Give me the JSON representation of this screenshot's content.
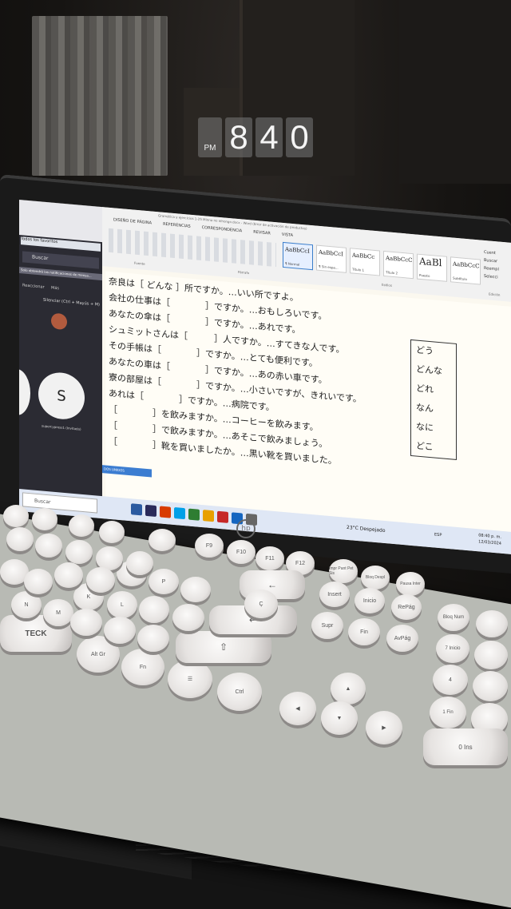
{
  "clock": {
    "period": "PM",
    "digits": [
      "8",
      "4",
      "0"
    ]
  },
  "browser": {
    "favorites": "Todos los favoritos",
    "search": "Buscar",
    "notification": "Solo obtendrá las notificaciones de mensa...",
    "react": "Reaccionar",
    "more": "Más",
    "mute_hint": "Silenciar (Ctrl + Mayús + M)",
    "avatar_letter": "S",
    "guest": "supercypress1 (Invitado)",
    "banner": "DOS UNIDOS"
  },
  "word": {
    "doc_title": "Gramática y ejercicios 1-25 Minna no nihongo.docx - Word (Error de activación de productos)",
    "tabs": [
      "DISEÑO DE PÁGINA",
      "REFERENCIAS",
      "CORRESPONDENCIA",
      "REVISAR",
      "VISTA"
    ],
    "styles": [
      {
        "sample": "AaBbCcI",
        "name": "¶ Normal"
      },
      {
        "sample": "AaBbCcI",
        "name": "¶ Sin espa..."
      },
      {
        "sample": "AaBbCc",
        "name": "Título 1"
      },
      {
        "sample": "AaBbCcC",
        "name": "Título 2"
      },
      {
        "sample": "AaBl",
        "name": "Puesto"
      },
      {
        "sample": "AaBbCcC",
        "name": "Subtítulo"
      }
    ],
    "right_tools": [
      "Cuent",
      "Buscar",
      "Reempl",
      "Selecci"
    ],
    "groups": {
      "fuente": "Fuente",
      "parrafo": "Párrafo",
      "estilos": "Estilos",
      "edicion": "Edición"
    },
    "lines": [
      "奈良は［ どんな ］所ですか。…いい所ですよ。",
      "会社の仕事は［　　　　］ですか。…おもしろいです。",
      "あなたの傘は［　　　　］ですか。…あれです。",
      "シュミットさんは［　　　］人ですか。…すてきな人です。",
      "その手帳は［　　　　］ですか。…とても便利です。",
      "あなたの車は［　　　　］ですか。…あの赤い車です。",
      "寮の部屋は［　　　　］ですか。…小さいですが、きれいです。",
      "あれは［　　　　］ですか。…病院です。",
      "［　　　　］を飲みますか。…コーヒーを飲みます。",
      "［　　　　］で飲みますか。…あそこで飲みましょう。",
      "［　　　　］靴を買いましたか。…黒い靴を買いました。"
    ],
    "word_bank": [
      "どう",
      "どんな",
      "どれ",
      "なん",
      "なに",
      "どこ"
    ]
  },
  "taskbar": {
    "search": "Buscar",
    "weather": "23°C Despejado",
    "lang": "ESP",
    "time": "08:40 p. m.",
    "date": "12/03/2024"
  },
  "laptop": {
    "brand": "hp"
  },
  "keyboard": {
    "brand": "TECK",
    "keys": [
      "F9",
      "F10",
      "F11",
      "F12",
      "Impr Pant Pet Sis",
      "Bloq Despl",
      "Pausa Inter",
      "Insert",
      "Inicio",
      "RePág",
      "Supr",
      "Fin",
      "AvPág",
      "Bloq Num",
      "7 Inicio",
      "4",
      "1 Fin",
      "0 Ins",
      "Alt Gr",
      "Fn",
      "Ctrl",
      "Ç",
      "N",
      "M",
      "K",
      "L",
      "O",
      "P"
    ]
  }
}
